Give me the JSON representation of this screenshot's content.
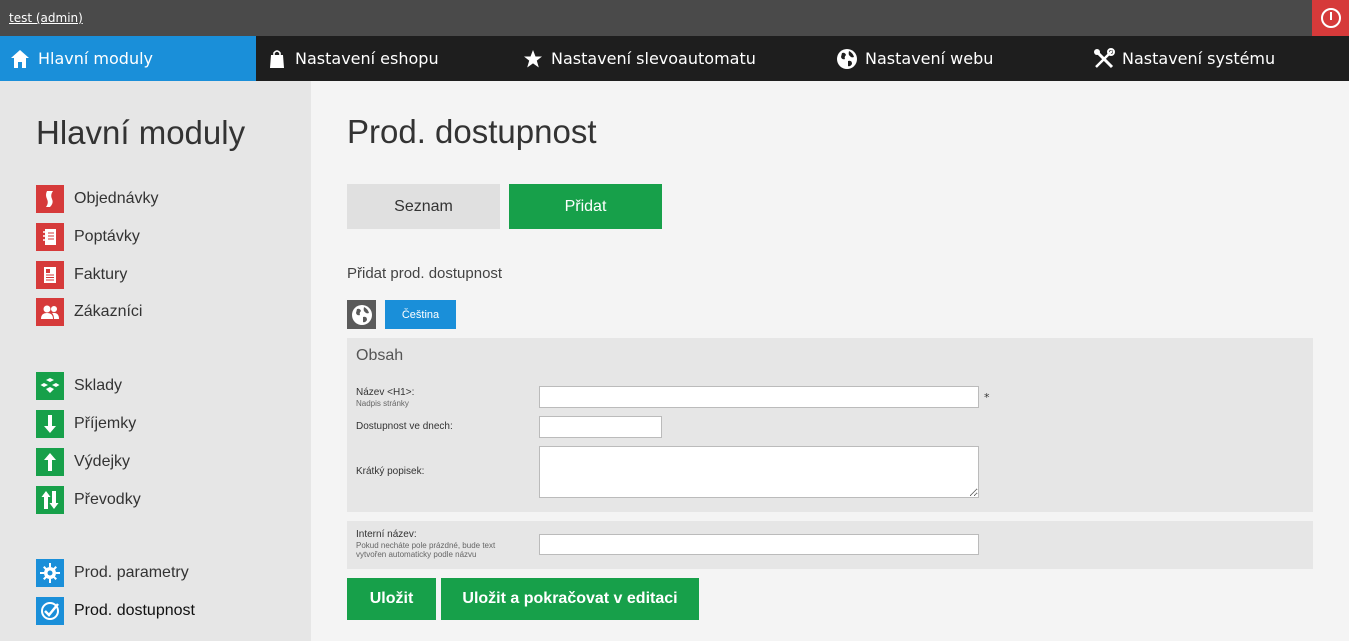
{
  "topbar": {
    "user": "test (admin)"
  },
  "nav": {
    "items": [
      {
        "label": "Hlavní moduly",
        "icon": "home-icon"
      },
      {
        "label": "Nastavení eshopu",
        "icon": "shopping-bag-icon"
      },
      {
        "label": "Nastavení slevoautomatu",
        "icon": "star-icon"
      },
      {
        "label": "Nastavení webu",
        "icon": "globe-icon"
      },
      {
        "label": "Nastavení systému",
        "icon": "tools-icon"
      }
    ]
  },
  "sidebar": {
    "title": "Hlavní moduly",
    "items": [
      {
        "label": "Objednávky",
        "icon": "orders-icon",
        "color": "#d63a3a"
      },
      {
        "label": "Poptávky",
        "icon": "notebook-icon",
        "color": "#d63a3a"
      },
      {
        "label": "Faktury",
        "icon": "invoice-icon",
        "color": "#d63a3a"
      },
      {
        "label": "Zákazníci",
        "icon": "users-icon",
        "color": "#d63a3a"
      },
      {
        "label": "Sklady",
        "icon": "boxes-icon",
        "color": "#17a04a"
      },
      {
        "label": "Příjemky",
        "icon": "arrow-down-icon",
        "color": "#17a04a"
      },
      {
        "label": "Výdejky",
        "icon": "arrow-up-icon",
        "color": "#17a04a"
      },
      {
        "label": "Převodky",
        "icon": "transfer-icon",
        "color": "#17a04a"
      },
      {
        "label": "Prod. parametry",
        "icon": "gear-icon",
        "color": "#1a8fd9"
      },
      {
        "label": "Prod. dostupnost",
        "icon": "check-circle-icon",
        "color": "#1a8fd9"
      }
    ]
  },
  "main": {
    "title": "Prod. dostupnost",
    "tabs": [
      {
        "label": "Seznam"
      },
      {
        "label": "Přidat"
      }
    ],
    "subheading": "Přidat prod. dostupnost",
    "language_button": "Čeština",
    "content_panel": {
      "title": "Obsah",
      "fields": [
        {
          "label": "Název <H1>:",
          "sublabel": "Nadpis stránky",
          "value": "",
          "required_mark": "*"
        },
        {
          "label": "Dostupnost ve dnech:",
          "value": ""
        },
        {
          "label": "Krátký popisek:",
          "value": ""
        }
      ]
    },
    "internal": {
      "label": "Interní název:",
      "sublabel": "Pokud necháte pole prázdné, bude text vytvořen automaticky podle názvu",
      "value": ""
    },
    "buttons": {
      "save": "Uložit",
      "save_continue": "Uložit a pokračovat v editaci"
    }
  },
  "colors": {
    "accent_blue": "#1a8fd9",
    "accent_green": "#17a04a",
    "accent_red": "#d63a3a",
    "nav_bg": "#1e1e1e",
    "topbar_bg": "#4a4a4a"
  }
}
